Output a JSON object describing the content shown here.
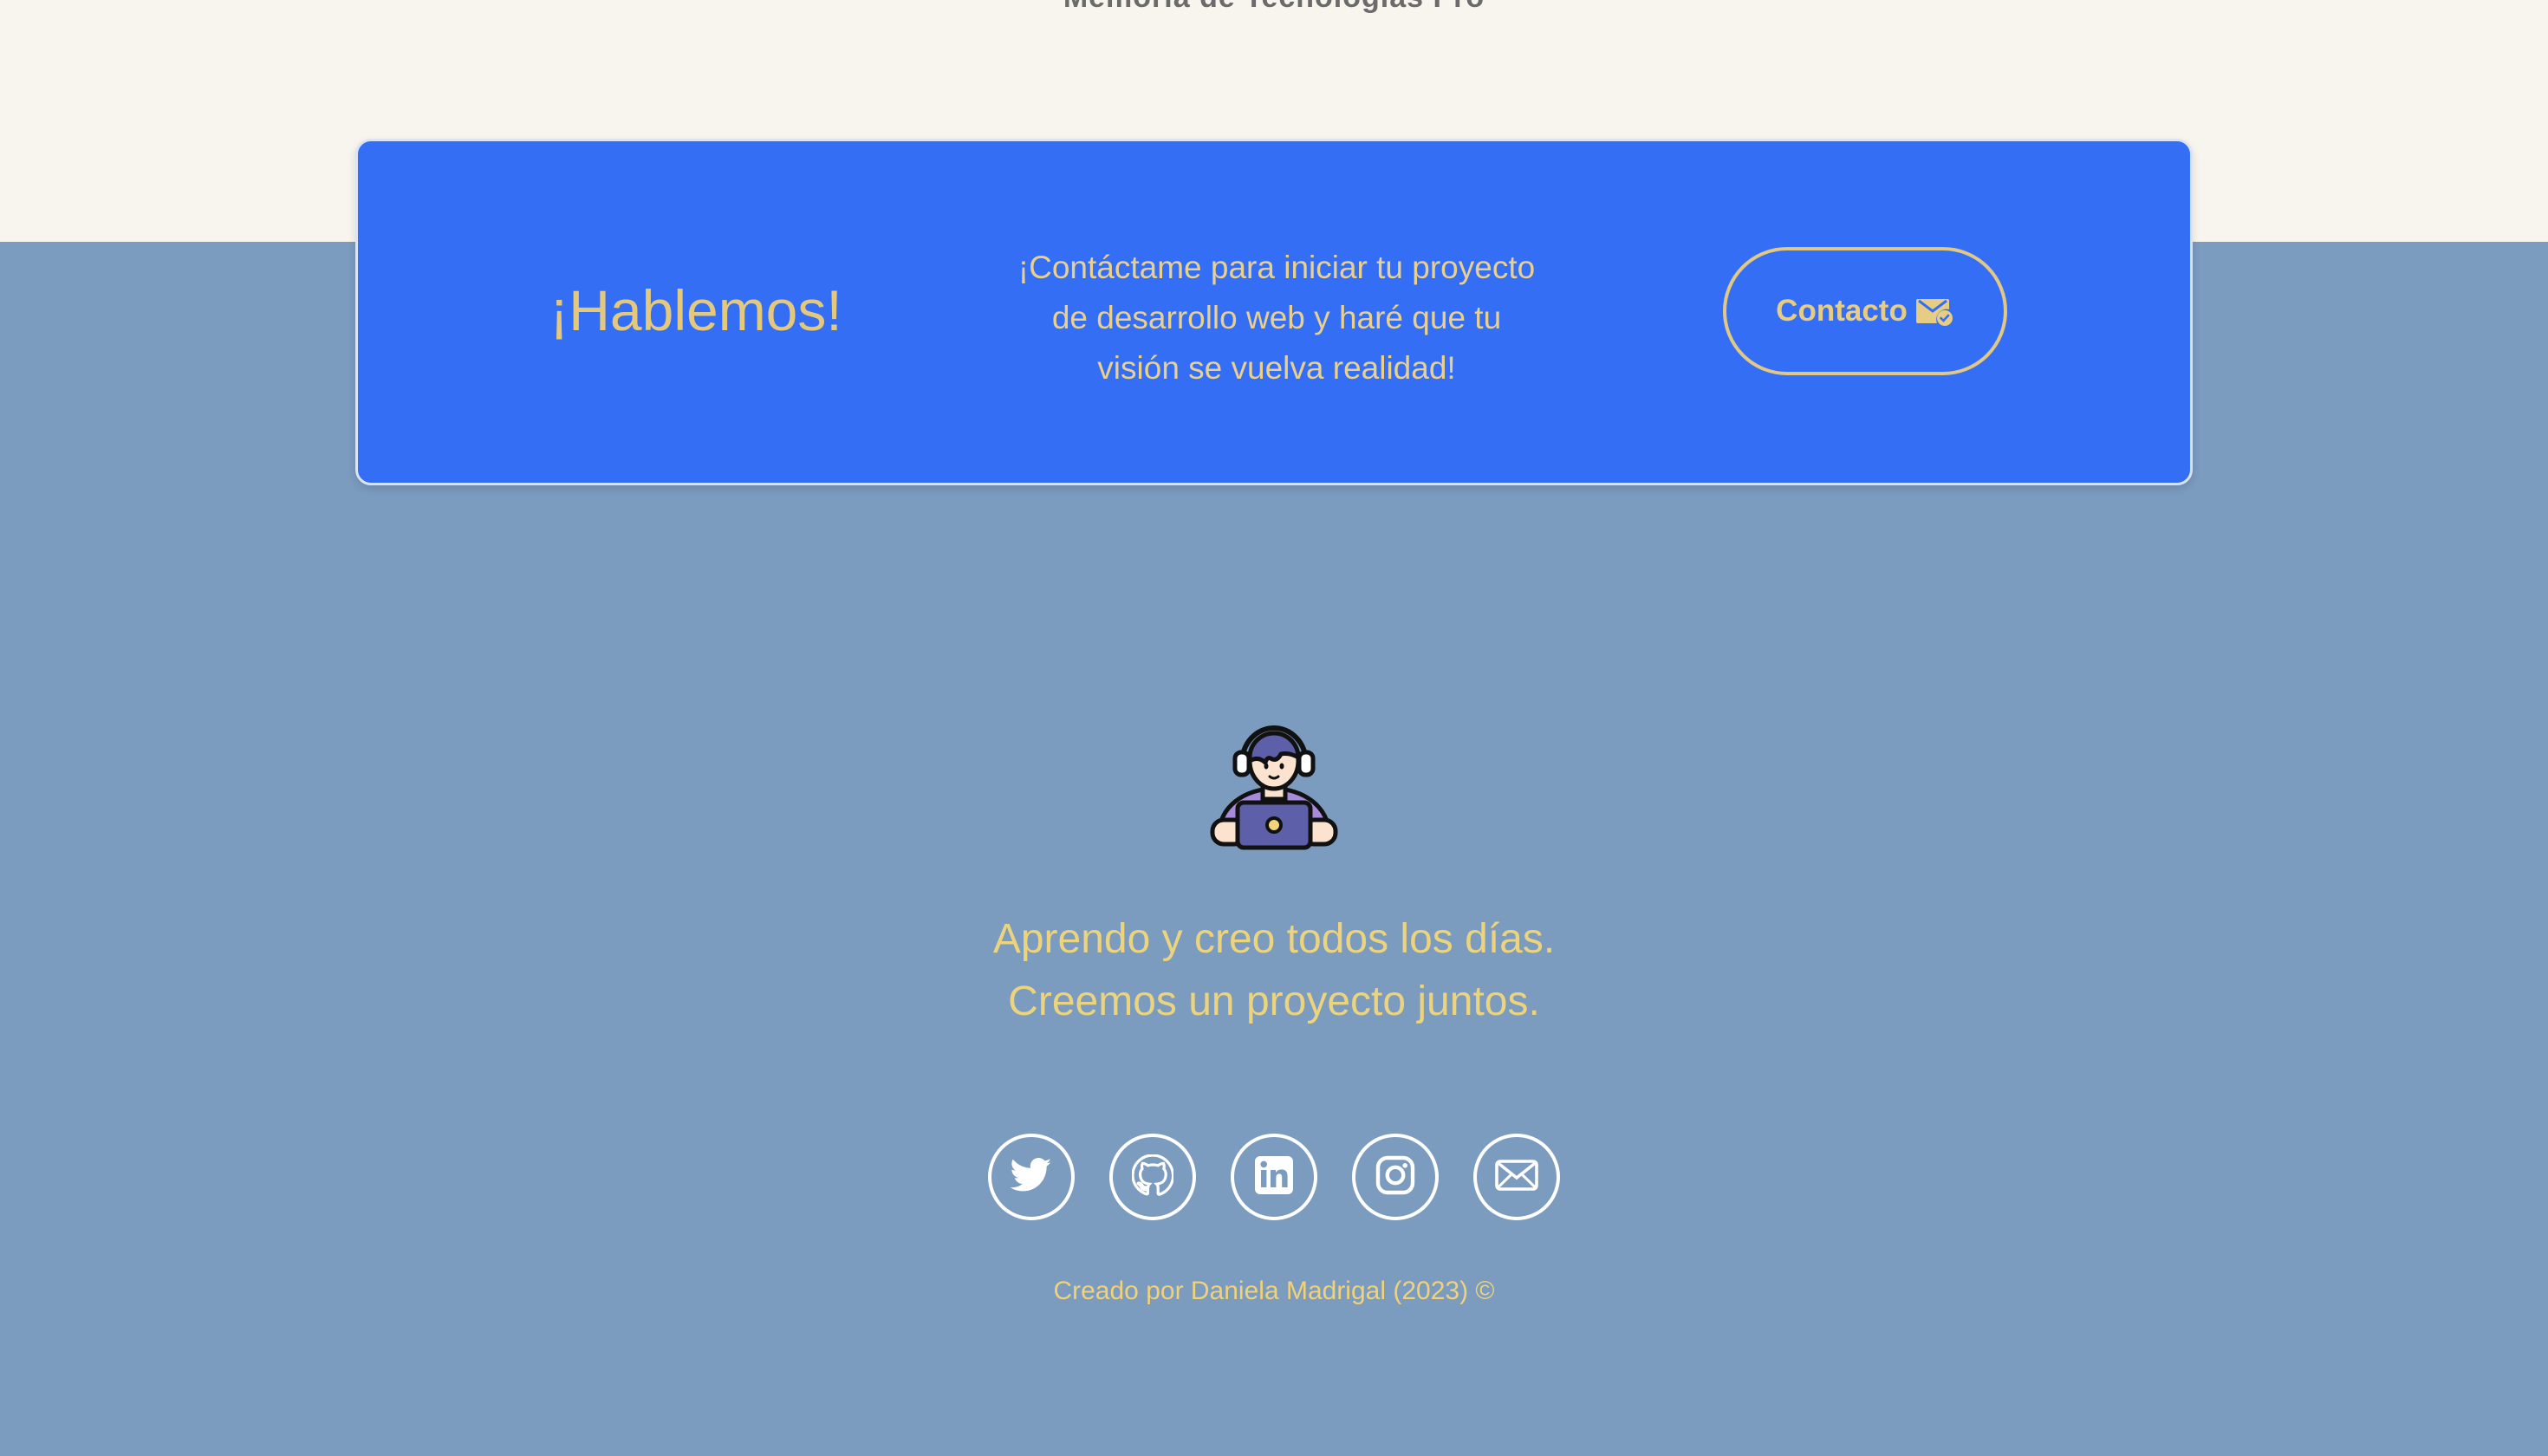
{
  "page": {
    "cut_text": "Memoria de Tecnologías Pro"
  },
  "cta": {
    "title": "¡Hablemos!",
    "text_line1": "¡Contáctame para iniciar tu proyecto",
    "text_line2": "de desarrollo web y haré que tu",
    "text_line3": "visión se vuelva realidad!",
    "button_label": "Contacto",
    "button_icon": "envelope-check-icon"
  },
  "hero": {
    "avatar_icon": "developer-avatar-icon",
    "tagline_line1": "Aprendo y creo todos los días.",
    "tagline_line2": "Creemos un proyecto juntos."
  },
  "socials": [
    {
      "name": "twitter",
      "icon": "twitter-icon"
    },
    {
      "name": "github",
      "icon": "github-icon"
    },
    {
      "name": "linkedin",
      "icon": "linkedin-icon"
    },
    {
      "name": "instagram",
      "icon": "instagram-icon"
    },
    {
      "name": "email",
      "icon": "mail-icon"
    }
  ],
  "footer": {
    "credit": "Creado por Daniela Madrigal (2023) ©"
  },
  "colors": {
    "top_band": "#f8f5ee",
    "background": "#7b9bbf",
    "card": "#346ef5",
    "accent_gold": "#e4c97c"
  }
}
